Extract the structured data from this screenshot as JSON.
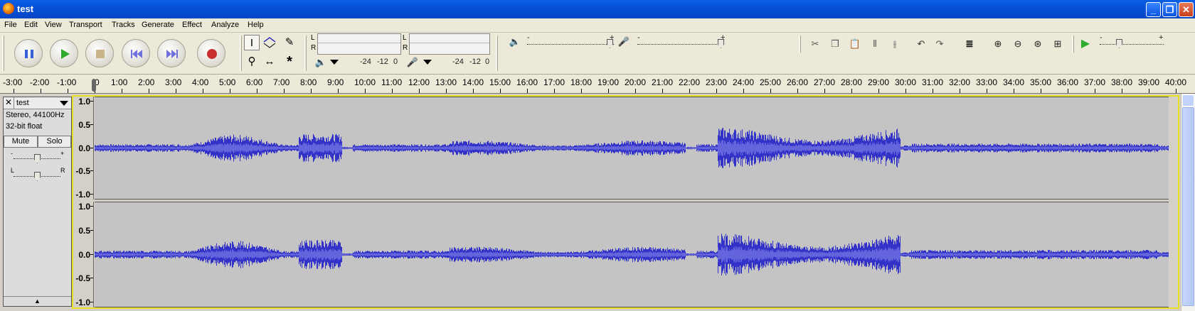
{
  "window": {
    "title": "test"
  },
  "menu": [
    "File",
    "Edit",
    "View",
    "Transport",
    "Tracks",
    "Generate",
    "Effect",
    "Analyze",
    "Help"
  ],
  "meters": {
    "output": {
      "channels": [
        "L",
        "R"
      ],
      "scale": [
        "-24",
        "-12",
        "0"
      ]
    },
    "input": {
      "channels": [
        "L",
        "R"
      ],
      "scale": [
        "-24",
        "-12",
        "0"
      ]
    }
  },
  "mixer": {
    "minus": "-",
    "plus": "+"
  },
  "playback_speed": {
    "minus": "-",
    "plus": "+"
  },
  "ruler": {
    "labels": [
      "-3:00",
      "-2:00",
      "-1:00",
      "0",
      "1:00",
      "2:00",
      "3:00",
      "4:00",
      "5:00",
      "6:00",
      "7:00",
      "8:00",
      "9:00",
      "10:00",
      "11:00",
      "12:00",
      "13:00",
      "14:00",
      "15:00",
      "16:00",
      "17:00",
      "18:00",
      "19:00",
      "20:00",
      "21:00",
      "22:00",
      "23:00",
      "24:00",
      "25:00",
      "26:00",
      "27:00",
      "28:00",
      "29:00",
      "30:00",
      "31:00",
      "32:00",
      "33:00",
      "34:00",
      "35:00",
      "36:00",
      "37:00",
      "38:00",
      "39:00",
      "40:00"
    ]
  },
  "track": {
    "name": "test",
    "format": "Stereo, 44100Hz",
    "bitdepth": "32-bit float",
    "mute_label": "Mute",
    "solo_label": "Solo",
    "gain_minus": "-",
    "gain_plus": "+",
    "pan_left": "L",
    "pan_right": "R",
    "amplitude_labels": [
      "1.0",
      "0.5",
      "0.0",
      "-0.5",
      "-1.0"
    ]
  },
  "colors": {
    "waveform": "#3232c8",
    "waveform_rms": "#6464dc",
    "track_bg": "#c4c4c4",
    "selection_border": "#e8e020"
  }
}
